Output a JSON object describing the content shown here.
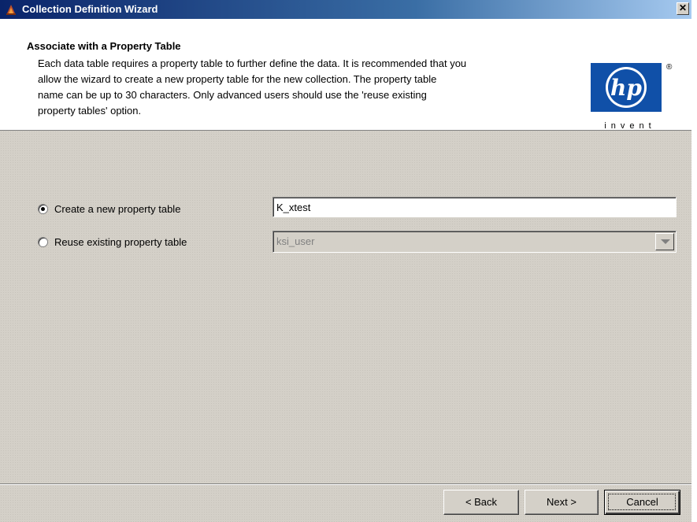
{
  "window": {
    "title": "Collection Definition Wizard",
    "app_icon": "wizard-app-icon",
    "close_glyph": "✕"
  },
  "header": {
    "title": "Associate with a Property Table",
    "description_lines": [
      "Each data table requires a property table to further define the data. It is recommended that you",
      "allow the wizard to create a new property table for the new collection. The property table",
      "name can be up to 30 characters. Only advanced users should use the 'reuse existing",
      "property tables' option."
    ],
    "logo": {
      "mark": "hp",
      "registered": "®",
      "tagline": "invent",
      "color": "#1050a8"
    }
  },
  "options": {
    "create_new": {
      "label": "Create a new property table",
      "selected": true,
      "value": "K_xtest"
    },
    "reuse_existing": {
      "label": "Reuse existing property table",
      "selected": false,
      "value": "ksi_user"
    }
  },
  "buttons": {
    "back": "< Back",
    "next": "Next >",
    "cancel": "Cancel"
  }
}
